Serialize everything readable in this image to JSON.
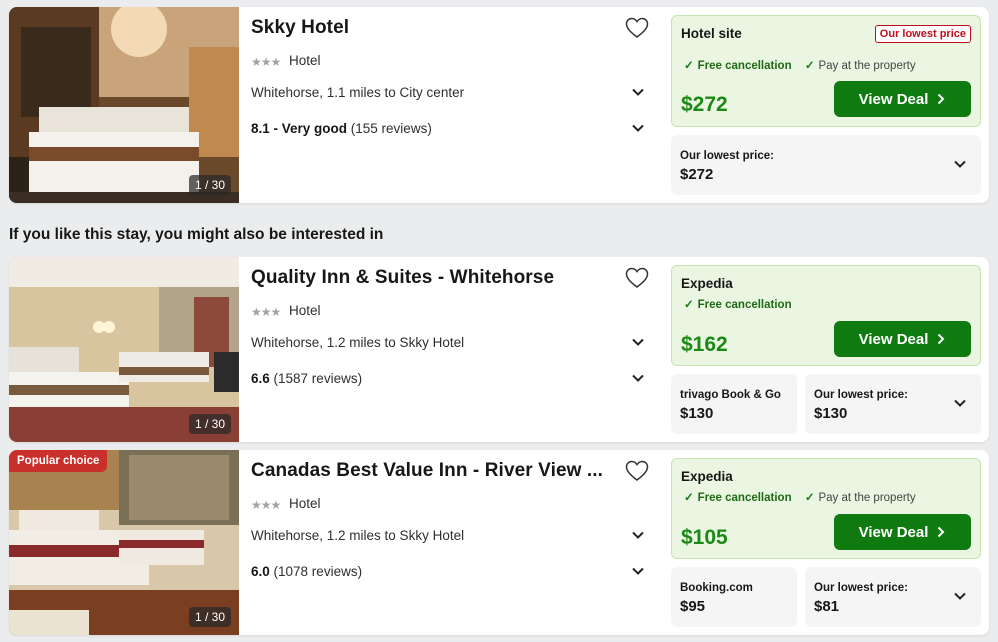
{
  "colors": {
    "green_price": "#1b8914",
    "cta_green": "#0f7a0f",
    "deal_bg": "#ebf6e2",
    "badge_red": "#c20e1a"
  },
  "section_heading": "If you like this stay, you might also be interested in",
  "hotels": [
    {
      "name": "Skky Hotel",
      "stars": "★★★",
      "type": "Hotel",
      "location": "Whitehorse, 1.1 miles to City center",
      "rating_bold": "8.1 - Very good",
      "rating_rest": " (155 reviews)",
      "photo_counter": "1 / 30",
      "deal": {
        "provider": "Hotel site",
        "badge": "Our lowest price",
        "perk1": "Free cancellation",
        "perk2": "Pay at the property",
        "price": "$272",
        "button": "View Deal"
      },
      "sub": [
        {
          "label": "Our lowest price:",
          "price": "$272"
        }
      ]
    },
    {
      "name": "Quality Inn & Suites - Whitehorse",
      "stars": "★★★",
      "type": "Hotel",
      "location": "Whitehorse, 1.2 miles to Skky Hotel",
      "rating_bold": "6.6",
      "rating_rest": " (1587 reviews)",
      "photo_counter": "1 / 30",
      "deal": {
        "provider": "Expedia",
        "perk1": "Free cancellation",
        "price": "$162",
        "button": "View Deal"
      },
      "sub": [
        {
          "label": "trivago Book & Go",
          "price": "$130"
        },
        {
          "label": "Our lowest price:",
          "price": "$130"
        }
      ]
    },
    {
      "name": "Canadas Best Value Inn - River View ...",
      "stars": "★★★",
      "type": "Hotel",
      "location": "Whitehorse, 1.2 miles to Skky Hotel",
      "rating_bold": "6.0",
      "rating_rest": " (1078 reviews)",
      "photo_counter": "1 / 30",
      "popular": "Popular choice",
      "deal": {
        "provider": "Expedia",
        "perk1": "Free cancellation",
        "perk2": "Pay at the property",
        "price": "$105",
        "button": "View Deal"
      },
      "sub": [
        {
          "label": "Booking.com",
          "price": "$95"
        },
        {
          "label": "Our lowest price:",
          "price": "$81"
        }
      ]
    }
  ]
}
